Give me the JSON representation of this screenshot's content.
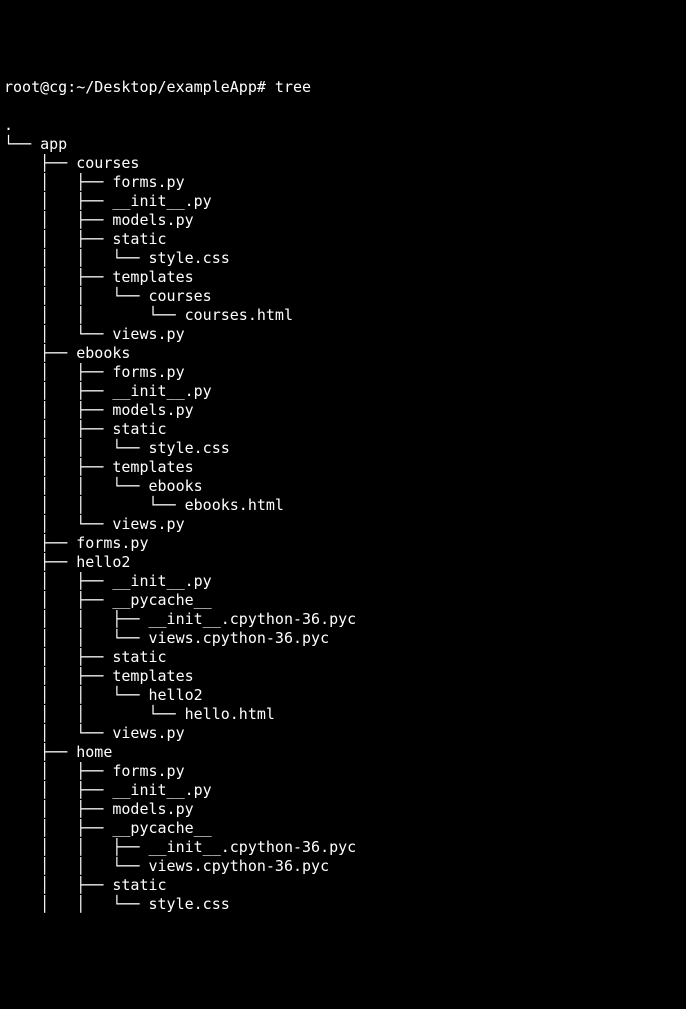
{
  "prompt": "root@cg:~/Desktop/exampleApp# tree",
  "lines": [
    ".",
    "└── app",
    "    ├── courses",
    "    │   ├── forms.py",
    "    │   ├── __init__.py",
    "    │   ├── models.py",
    "    │   ├── static",
    "    │   │   └── style.css",
    "    │   ├── templates",
    "    │   │   └── courses",
    "    │   │       └── courses.html",
    "    │   └── views.py",
    "    ├── ebooks",
    "    │   ├── forms.py",
    "    │   ├── __init__.py",
    "    │   ├── models.py",
    "    │   ├── static",
    "    │   │   └── style.css",
    "    │   ├── templates",
    "    │   │   └── ebooks",
    "    │   │       └── ebooks.html",
    "    │   └── views.py",
    "    ├── forms.py",
    "    ├── hello2",
    "    │   ├── __init__.py",
    "    │   ├── __pycache__",
    "    │   │   ├── __init__.cpython-36.pyc",
    "    │   │   └── views.cpython-36.pyc",
    "    │   ├── static",
    "    │   ├── templates",
    "    │   │   └── hello2",
    "    │   │       └── hello.html",
    "    │   └── views.py",
    "    ├── home",
    "    │   ├── forms.py",
    "    │   ├── __init__.py",
    "    │   ├── models.py",
    "    │   ├── __pycache__",
    "    │   │   ├── __init__.cpython-36.pyc",
    "    │   │   └── views.cpython-36.pyc",
    "    │   ├── static",
    "    │   │   └── style.css"
  ]
}
